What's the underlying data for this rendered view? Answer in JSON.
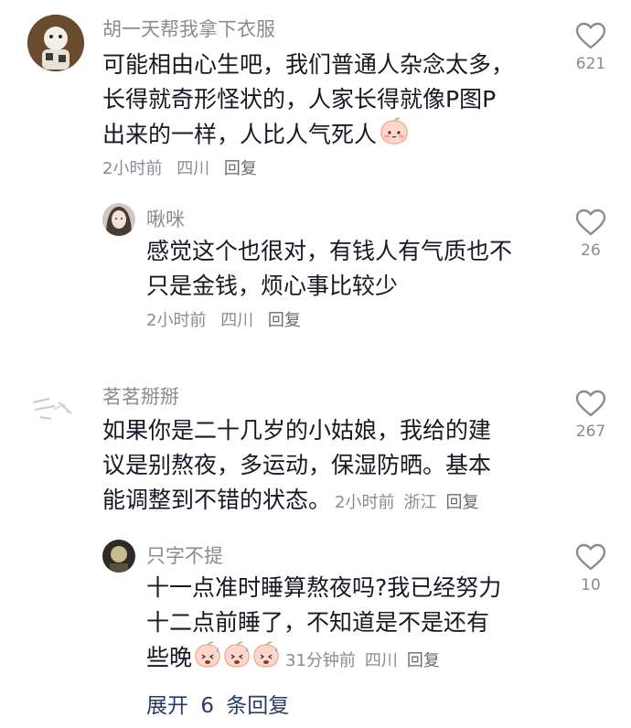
{
  "comments": [
    {
      "username": "胡一天帮我拿下衣服",
      "lines": [
        "可能相由心生吧，我们普通人杂念太多，",
        "长得就奇形怪状的，人家长得就像P图P",
        "出来的一样，人比人气死人"
      ],
      "time": "2小时前",
      "location": "四川",
      "reply": "回复",
      "likes": "621",
      "emoji": "peach-face"
    },
    {
      "username": "啾咪",
      "lines": [
        "感觉这个也很对，有钱人有气质也不",
        "只是金钱，烦心事比较少"
      ],
      "time": "2小时前",
      "location": "四川",
      "reply": "回复",
      "likes": "26"
    },
    {
      "username": "茗茗掰掰",
      "lines": [
        "如果你是二十几岁的小姑娘，我给的建",
        "议是别熬夜，多运动，保湿防晒。基本",
        "能调整到不错的状态。"
      ],
      "time": "2小时前",
      "location": "浙江",
      "reply": "回复",
      "likes": "267"
    },
    {
      "username": "只字不提",
      "lines": [
        "十一点准时睡算熬夜吗?我已经努力",
        "十二点前睡了，不知道是不是还有",
        "些晚"
      ],
      "time": "31分钟前",
      "location": "四川",
      "reply": "回复",
      "likes": "10",
      "emoji": "sweating-peach-face"
    }
  ],
  "expand": {
    "prefix": "展开",
    "count": "6",
    "suffix": "条回复"
  }
}
